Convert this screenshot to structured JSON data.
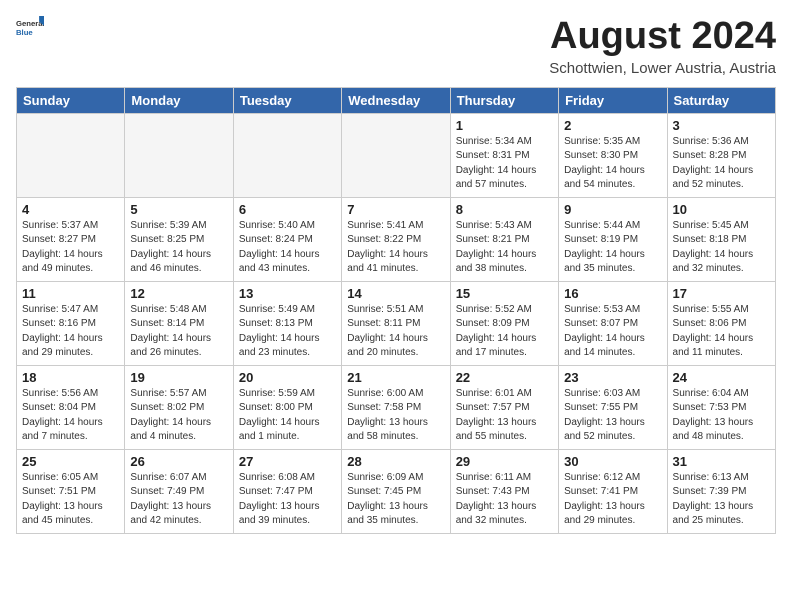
{
  "logo": {
    "text_general": "General",
    "text_blue": "Blue"
  },
  "header": {
    "month_title": "August 2024",
    "subtitle": "Schottwien, Lower Austria, Austria"
  },
  "weekdays": [
    "Sunday",
    "Monday",
    "Tuesday",
    "Wednesday",
    "Thursday",
    "Friday",
    "Saturday"
  ],
  "weeks": [
    [
      {
        "day": "",
        "info": ""
      },
      {
        "day": "",
        "info": ""
      },
      {
        "day": "",
        "info": ""
      },
      {
        "day": "",
        "info": ""
      },
      {
        "day": "1",
        "info": "Sunrise: 5:34 AM\nSunset: 8:31 PM\nDaylight: 14 hours\nand 57 minutes."
      },
      {
        "day": "2",
        "info": "Sunrise: 5:35 AM\nSunset: 8:30 PM\nDaylight: 14 hours\nand 54 minutes."
      },
      {
        "day": "3",
        "info": "Sunrise: 5:36 AM\nSunset: 8:28 PM\nDaylight: 14 hours\nand 52 minutes."
      }
    ],
    [
      {
        "day": "4",
        "info": "Sunrise: 5:37 AM\nSunset: 8:27 PM\nDaylight: 14 hours\nand 49 minutes."
      },
      {
        "day": "5",
        "info": "Sunrise: 5:39 AM\nSunset: 8:25 PM\nDaylight: 14 hours\nand 46 minutes."
      },
      {
        "day": "6",
        "info": "Sunrise: 5:40 AM\nSunset: 8:24 PM\nDaylight: 14 hours\nand 43 minutes."
      },
      {
        "day": "7",
        "info": "Sunrise: 5:41 AM\nSunset: 8:22 PM\nDaylight: 14 hours\nand 41 minutes."
      },
      {
        "day": "8",
        "info": "Sunrise: 5:43 AM\nSunset: 8:21 PM\nDaylight: 14 hours\nand 38 minutes."
      },
      {
        "day": "9",
        "info": "Sunrise: 5:44 AM\nSunset: 8:19 PM\nDaylight: 14 hours\nand 35 minutes."
      },
      {
        "day": "10",
        "info": "Sunrise: 5:45 AM\nSunset: 8:18 PM\nDaylight: 14 hours\nand 32 minutes."
      }
    ],
    [
      {
        "day": "11",
        "info": "Sunrise: 5:47 AM\nSunset: 8:16 PM\nDaylight: 14 hours\nand 29 minutes."
      },
      {
        "day": "12",
        "info": "Sunrise: 5:48 AM\nSunset: 8:14 PM\nDaylight: 14 hours\nand 26 minutes."
      },
      {
        "day": "13",
        "info": "Sunrise: 5:49 AM\nSunset: 8:13 PM\nDaylight: 14 hours\nand 23 minutes."
      },
      {
        "day": "14",
        "info": "Sunrise: 5:51 AM\nSunset: 8:11 PM\nDaylight: 14 hours\nand 20 minutes."
      },
      {
        "day": "15",
        "info": "Sunrise: 5:52 AM\nSunset: 8:09 PM\nDaylight: 14 hours\nand 17 minutes."
      },
      {
        "day": "16",
        "info": "Sunrise: 5:53 AM\nSunset: 8:07 PM\nDaylight: 14 hours\nand 14 minutes."
      },
      {
        "day": "17",
        "info": "Sunrise: 5:55 AM\nSunset: 8:06 PM\nDaylight: 14 hours\nand 11 minutes."
      }
    ],
    [
      {
        "day": "18",
        "info": "Sunrise: 5:56 AM\nSunset: 8:04 PM\nDaylight: 14 hours\nand 7 minutes."
      },
      {
        "day": "19",
        "info": "Sunrise: 5:57 AM\nSunset: 8:02 PM\nDaylight: 14 hours\nand 4 minutes."
      },
      {
        "day": "20",
        "info": "Sunrise: 5:59 AM\nSunset: 8:00 PM\nDaylight: 14 hours\nand 1 minute."
      },
      {
        "day": "21",
        "info": "Sunrise: 6:00 AM\nSunset: 7:58 PM\nDaylight: 13 hours\nand 58 minutes."
      },
      {
        "day": "22",
        "info": "Sunrise: 6:01 AM\nSunset: 7:57 PM\nDaylight: 13 hours\nand 55 minutes."
      },
      {
        "day": "23",
        "info": "Sunrise: 6:03 AM\nSunset: 7:55 PM\nDaylight: 13 hours\nand 52 minutes."
      },
      {
        "day": "24",
        "info": "Sunrise: 6:04 AM\nSunset: 7:53 PM\nDaylight: 13 hours\nand 48 minutes."
      }
    ],
    [
      {
        "day": "25",
        "info": "Sunrise: 6:05 AM\nSunset: 7:51 PM\nDaylight: 13 hours\nand 45 minutes."
      },
      {
        "day": "26",
        "info": "Sunrise: 6:07 AM\nSunset: 7:49 PM\nDaylight: 13 hours\nand 42 minutes."
      },
      {
        "day": "27",
        "info": "Sunrise: 6:08 AM\nSunset: 7:47 PM\nDaylight: 13 hours\nand 39 minutes."
      },
      {
        "day": "28",
        "info": "Sunrise: 6:09 AM\nSunset: 7:45 PM\nDaylight: 13 hours\nand 35 minutes."
      },
      {
        "day": "29",
        "info": "Sunrise: 6:11 AM\nSunset: 7:43 PM\nDaylight: 13 hours\nand 32 minutes."
      },
      {
        "day": "30",
        "info": "Sunrise: 6:12 AM\nSunset: 7:41 PM\nDaylight: 13 hours\nand 29 minutes."
      },
      {
        "day": "31",
        "info": "Sunrise: 6:13 AM\nSunset: 7:39 PM\nDaylight: 13 hours\nand 25 minutes."
      }
    ]
  ]
}
